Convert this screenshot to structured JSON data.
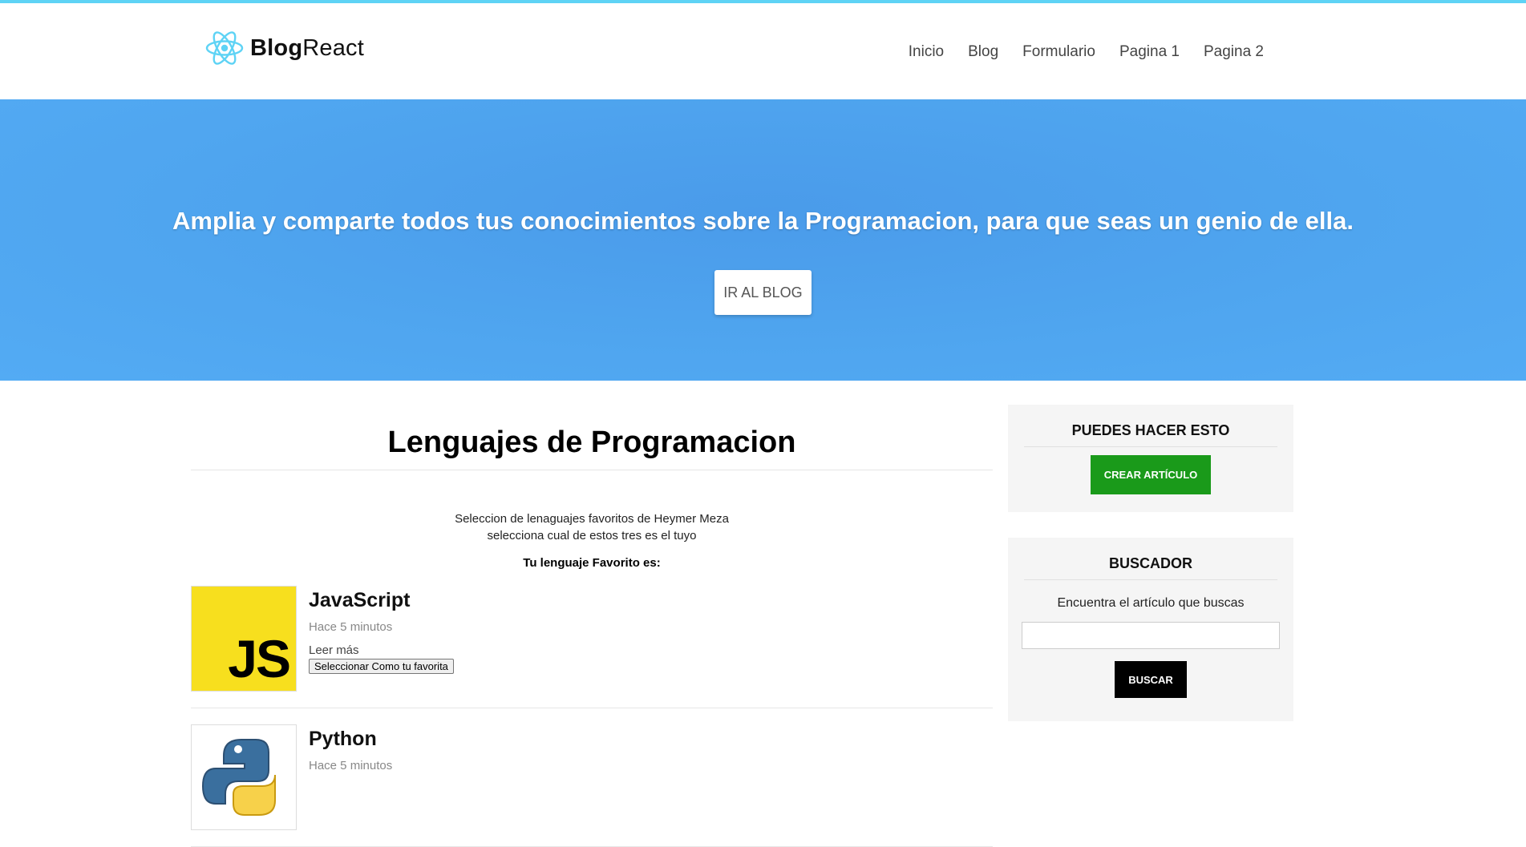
{
  "header": {
    "brand_bold": "Blog",
    "brand_rest": "React",
    "nav": [
      {
        "label": "Inicio"
      },
      {
        "label": "Blog"
      },
      {
        "label": "Formulario"
      },
      {
        "label": "Pagina 1"
      },
      {
        "label": "Pagina 2"
      }
    ]
  },
  "hero": {
    "title": "Amplia y comparte todos tus conocimientos sobre la Programacion, para que seas un genio de ella.",
    "button_label": "IR AL BLOG"
  },
  "main": {
    "title": "Lenguajes de Programacion",
    "intro_line1": "Seleccion de lenaguajes favoritos de Heymer Meza",
    "intro_line2": "selecciona cual de estos tres es el tuyo",
    "favorite_label": "Tu lenguaje Favorito es:",
    "articles": [
      {
        "name": "JavaScript",
        "logo_text": "JS",
        "time": "Hace 5 minutos",
        "read_more": "Leer más",
        "button": "Seleccionar Como tu favorita"
      },
      {
        "name": "Python",
        "time": "Hace 5 minutos"
      }
    ]
  },
  "sidebar": {
    "actions_title": "PUEDES HACER ESTO",
    "create_button": "CREAR ARTÍCULO",
    "search_title": "BUSCADOR",
    "search_desc": "Encuentra el artículo que buscas",
    "search_value": "",
    "search_button": "BUSCAR"
  },
  "colors": {
    "accent_bar": "#5ed3f5",
    "hero_bg": "#4fa5ef",
    "create_button": "#1a9a1a",
    "search_button": "#000000",
    "js_yellow": "#f7df1e"
  },
  "icons": [
    "react-atom-icon",
    "javascript-logo",
    "python-logo"
  ]
}
